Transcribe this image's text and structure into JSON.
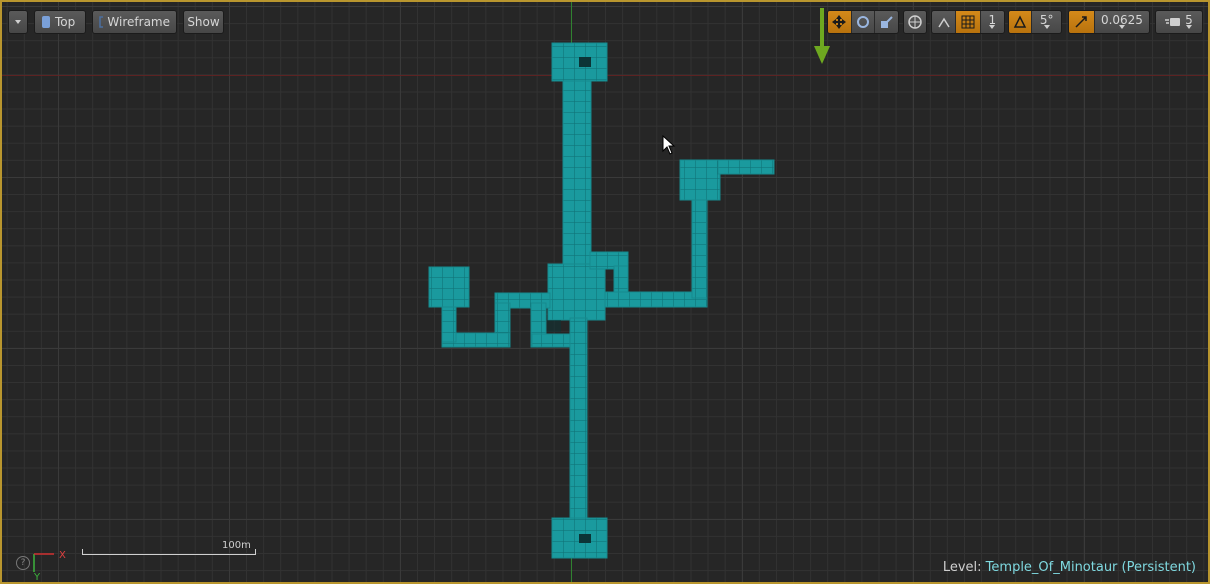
{
  "toolbar": {
    "view_mode": "Top",
    "render_mode": "Wireframe",
    "show_label": "Show",
    "grid_snap_value": "1",
    "rotation_snap_value": "5°",
    "scale_snap_value": "0.0625",
    "camera_speed_value": "5"
  },
  "viewport": {
    "scale_label": "100m",
    "axis_x_label": "X",
    "axis_y_label": "Y"
  },
  "status": {
    "level_prefix": "Level:",
    "level_name": "Temple_Of_Minotaur (Persistent)"
  },
  "colors": {
    "map_fill": "#1a9a9e",
    "map_grid": "#0f6f73",
    "viewport_border": "#b9962e",
    "snap_active": "#d48a1a"
  }
}
